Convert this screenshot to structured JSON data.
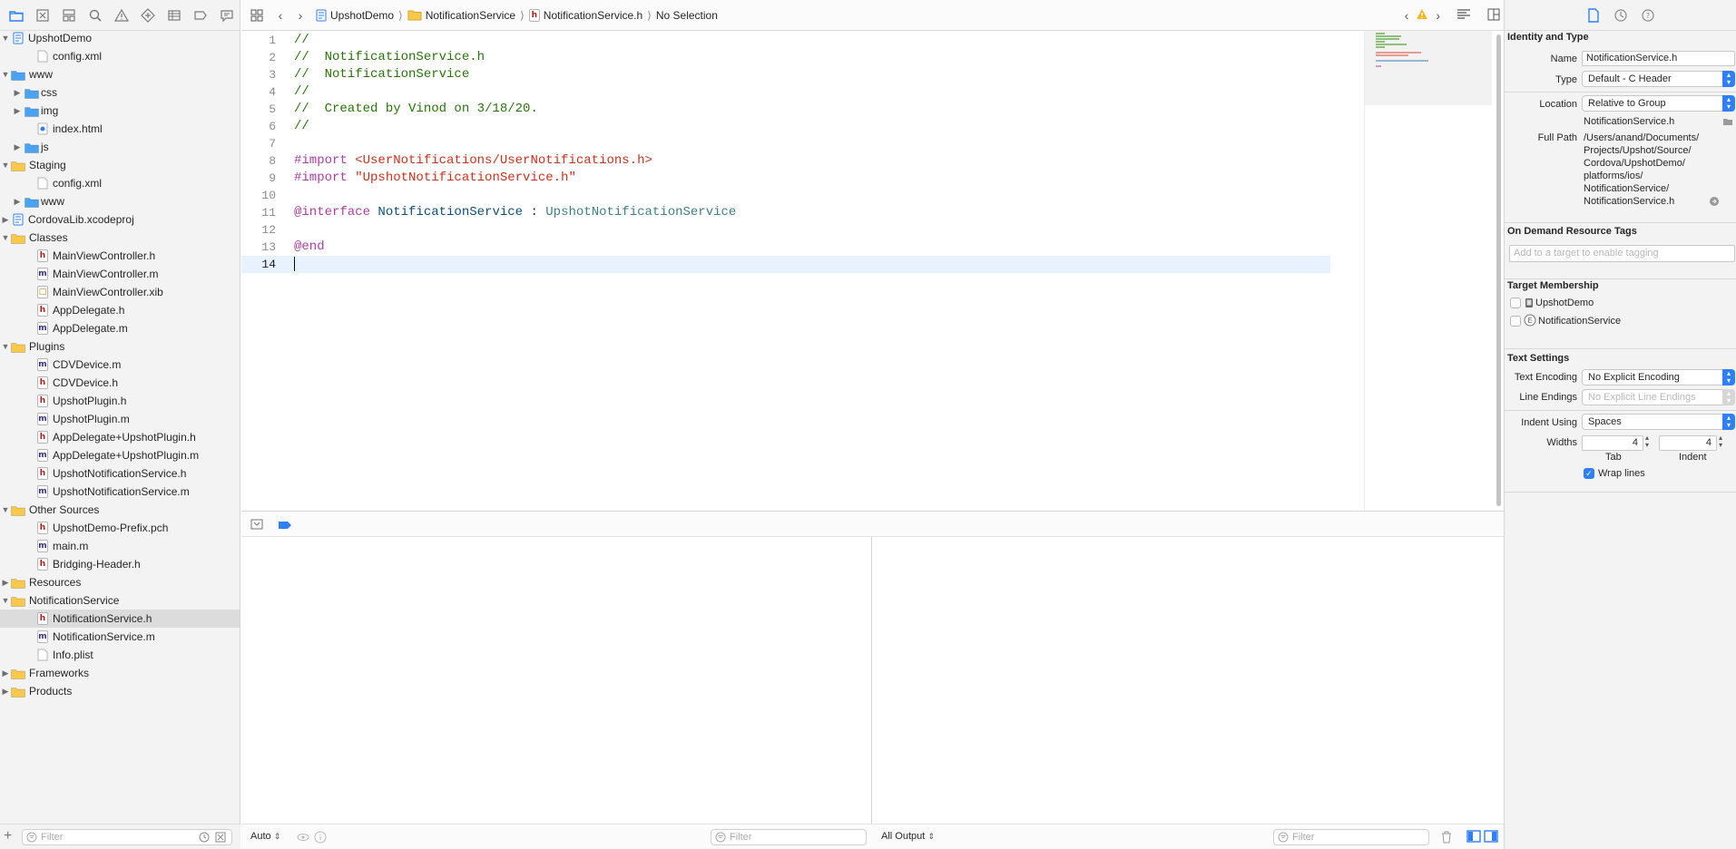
{
  "navigator": {
    "toolbar_icons": [
      "folder-icon",
      "source-control-icon",
      "symbol-icon",
      "find-icon",
      "issue-icon",
      "test-icon",
      "debug-icon",
      "breakpoint-icon",
      "report-icon"
    ],
    "tree": [
      {
        "label": "UpshotDemo",
        "kind": "project",
        "depth": 0,
        "open": true
      },
      {
        "label": "config.xml",
        "kind": "file",
        "depth": 1
      },
      {
        "label": "www",
        "kind": "folder-blue",
        "depth": 0,
        "open": true
      },
      {
        "label": "css",
        "kind": "folder-blue",
        "depth": 1,
        "open": false
      },
      {
        "label": "img",
        "kind": "folder-blue",
        "depth": 1,
        "open": false
      },
      {
        "label": "index.html",
        "kind": "html",
        "depth": 1
      },
      {
        "label": "js",
        "kind": "folder-blue",
        "depth": 1,
        "open": false
      },
      {
        "label": "Staging",
        "kind": "folder",
        "depth": 0,
        "open": true
      },
      {
        "label": "config.xml",
        "kind": "file",
        "depth": 1
      },
      {
        "label": "www",
        "kind": "folder-blue",
        "depth": 1,
        "open": false
      },
      {
        "label": "CordovaLib.xcodeproj",
        "kind": "project",
        "depth": 0,
        "open": false
      },
      {
        "label": "Classes",
        "kind": "folder",
        "depth": 0,
        "open": true
      },
      {
        "label": "MainViewController.h",
        "kind": "h",
        "depth": 1
      },
      {
        "label": "MainViewController.m",
        "kind": "m",
        "depth": 1
      },
      {
        "label": "MainViewController.xib",
        "kind": "x",
        "depth": 1
      },
      {
        "label": "AppDelegate.h",
        "kind": "h",
        "depth": 1
      },
      {
        "label": "AppDelegate.m",
        "kind": "m",
        "depth": 1
      },
      {
        "label": "Plugins",
        "kind": "folder",
        "depth": 0,
        "open": true
      },
      {
        "label": "CDVDevice.m",
        "kind": "m",
        "depth": 1
      },
      {
        "label": "CDVDevice.h",
        "kind": "h",
        "depth": 1
      },
      {
        "label": "UpshotPlugin.h",
        "kind": "h",
        "depth": 1
      },
      {
        "label": "UpshotPlugin.m",
        "kind": "m",
        "depth": 1
      },
      {
        "label": "AppDelegate+UpshotPlugin.h",
        "kind": "h",
        "depth": 1
      },
      {
        "label": "AppDelegate+UpshotPlugin.m",
        "kind": "m",
        "depth": 1
      },
      {
        "label": "UpshotNotificationService.h",
        "kind": "h",
        "depth": 1
      },
      {
        "label": "UpshotNotificationService.m",
        "kind": "m",
        "depth": 1
      },
      {
        "label": "Other Sources",
        "kind": "folder",
        "depth": 0,
        "open": true
      },
      {
        "label": "UpshotDemo-Prefix.pch",
        "kind": "h",
        "depth": 1
      },
      {
        "label": "main.m",
        "kind": "m",
        "depth": 1
      },
      {
        "label": "Bridging-Header.h",
        "kind": "h",
        "depth": 1
      },
      {
        "label": "Resources",
        "kind": "folder",
        "depth": 0,
        "open": false
      },
      {
        "label": "NotificationService",
        "kind": "folder",
        "depth": 0,
        "open": true
      },
      {
        "label": "NotificationService.h",
        "kind": "h",
        "depth": 1,
        "selected": true
      },
      {
        "label": "NotificationService.m",
        "kind": "m",
        "depth": 1
      },
      {
        "label": "Info.plist",
        "kind": "file",
        "depth": 1
      },
      {
        "label": "Frameworks",
        "kind": "folder",
        "depth": 0,
        "open": false
      },
      {
        "label": "Products",
        "kind": "folder",
        "depth": 0,
        "open": false
      }
    ],
    "filter_placeholder": "Filter"
  },
  "jumpbar": {
    "crumbs": [
      "UpshotDemo",
      "NotificationService",
      "NotificationService.h",
      "No Selection"
    ]
  },
  "editor": {
    "current_line": 14,
    "lines": [
      [
        {
          "t": "//",
          "c": "c-cm"
        }
      ],
      [
        {
          "t": "//  NotificationService.h",
          "c": "c-cm"
        }
      ],
      [
        {
          "t": "//  NotificationService",
          "c": "c-cm"
        }
      ],
      [
        {
          "t": "//",
          "c": "c-cm"
        }
      ],
      [
        {
          "t": "//  Created by Vinod on 3/18/20.",
          "c": "c-cm"
        }
      ],
      [
        {
          "t": "//",
          "c": "c-cm"
        }
      ],
      [],
      [
        {
          "t": "#import ",
          "c": "c-kw"
        },
        {
          "t": "<UserNotifications/UserNotifications.h>",
          "c": "c-str"
        }
      ],
      [
        {
          "t": "#import ",
          "c": "c-kw"
        },
        {
          "t": "\"UpshotNotificationService.h\"",
          "c": "c-str"
        }
      ],
      [],
      [
        {
          "t": "@interface ",
          "c": "c-kw"
        },
        {
          "t": "NotificationService",
          "c": "c-type"
        },
        {
          "t": " : ",
          "c": ""
        },
        {
          "t": "UpshotNotificationService",
          "c": "c-cls"
        }
      ],
      [],
      [
        {
          "t": "@end",
          "c": "c-kw"
        }
      ],
      []
    ]
  },
  "debug": {
    "variables_scope": "Auto",
    "left_filter_placeholder": "Filter",
    "console_output": "All Output",
    "right_filter_placeholder": "Filter"
  },
  "inspector": {
    "identity_title": "Identity and Type",
    "name_label": "Name",
    "name_value": "NotificationService.h",
    "type_label": "Type",
    "type_value": "Default - C Header",
    "location_label": "Location",
    "location_value": "Relative to Group",
    "location_file": "NotificationService.h",
    "fullpath_label": "Full Path",
    "fullpath_lines": [
      "/Users/anand/Documents/",
      "Projects/Upshot/Source/",
      "Cordova/UpshotDemo/",
      "platforms/ios/",
      "NotificationService/",
      "NotificationService.h"
    ],
    "odr_title": "On Demand Resource Tags",
    "odr_placeholder": "Add to a target to enable tagging",
    "target_title": "Target Membership",
    "targets": [
      {
        "label": "UpshotDemo",
        "checked": false
      },
      {
        "label": "NotificationService",
        "checked": false
      }
    ],
    "text_title": "Text Settings",
    "encoding_label": "Text Encoding",
    "encoding_value": "No Explicit Encoding",
    "endings_label": "Line Endings",
    "endings_value": "No Explicit Line Endings",
    "indent_using_label": "Indent Using",
    "indent_using_value": "Spaces",
    "widths_label": "Widths",
    "tab_value": "4",
    "indent_value": "4",
    "tab_caption": "Tab",
    "indent_caption": "Indent",
    "wrap_label": "Wrap lines",
    "wrap_checked": true
  },
  "colors": {
    "accent": "#2f7ff6",
    "folder_yellow": "#f7c84a",
    "folder_blue": "#4aa3f0"
  }
}
